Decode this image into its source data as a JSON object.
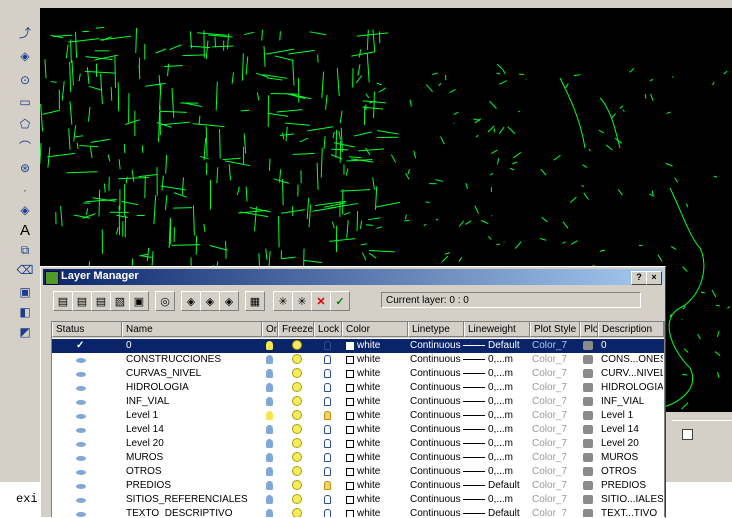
{
  "layer_manager": {
    "title": "Layer Manager",
    "help_button": "?",
    "close_button": "×",
    "current_layer": "Current layer: 0 : 0",
    "columns": [
      "Status",
      "Name",
      "On",
      "Freeze",
      "Lock",
      "Color",
      "Linetype",
      "Lineweight",
      "Plot Style",
      "Plot",
      "Description"
    ],
    "rows": [
      {
        "name": "0",
        "color": "white",
        "linetype": "Continuous",
        "lineweight": "Default",
        "plot_style": "Color_7",
        "description": "0",
        "selected": true,
        "on": true,
        "lock_gold": false
      },
      {
        "name": "CONSTRUCCIONES",
        "color": "white",
        "linetype": "Continuous",
        "lineweight": "0,...m",
        "plot_style": "Color_7",
        "description": "CONS...ONES",
        "on": false,
        "lock_gold": false
      },
      {
        "name": "CURVAS_NIVEL",
        "color": "white",
        "linetype": "Continuous",
        "lineweight": "0,...m",
        "plot_style": "Color_7",
        "description": "CURV...NIVEL",
        "on": false,
        "lock_gold": false
      },
      {
        "name": "HIDROLOGIA",
        "color": "white",
        "linetype": "Continuous",
        "lineweight": "0,...m",
        "plot_style": "Color_7",
        "description": "HIDROLOGIA",
        "on": false,
        "lock_gold": false
      },
      {
        "name": "INF_VIAL",
        "color": "white",
        "linetype": "Continuous",
        "lineweight": "0,...m",
        "plot_style": "Color_7",
        "description": "INF_VIAL",
        "on": false,
        "lock_gold": false
      },
      {
        "name": "Level 1",
        "color": "white",
        "linetype": "Continuous",
        "lineweight": "0,...m",
        "plot_style": "Color_7",
        "description": "Level 1",
        "on": true,
        "lock_gold": true
      },
      {
        "name": "Level 14",
        "color": "white",
        "linetype": "Continuous",
        "lineweight": "0,...m",
        "plot_style": "Color_7",
        "description": "Level 14",
        "on": false,
        "lock_gold": false
      },
      {
        "name": "Level 20",
        "color": "white",
        "linetype": "Continuous",
        "lineweight": "0,...m",
        "plot_style": "Color_7",
        "description": "Level 20",
        "on": false,
        "lock_gold": false
      },
      {
        "name": "MUROS",
        "color": "white",
        "linetype": "Continuous",
        "lineweight": "0,...m",
        "plot_style": "Color_7",
        "description": "MUROS",
        "on": false,
        "lock_gold": false
      },
      {
        "name": "OTROS",
        "color": "white",
        "linetype": "Continuous",
        "lineweight": "0,...m",
        "plot_style": "Color_7",
        "description": "OTROS",
        "on": false,
        "lock_gold": false
      },
      {
        "name": "PREDIOS",
        "color": "white",
        "linetype": "Continuous",
        "lineweight": "Default",
        "plot_style": "Color_7",
        "description": "PREDIOS",
        "on": false,
        "lock_gold": true
      },
      {
        "name": "SITIOS_REFERENCIALES",
        "color": "white",
        "linetype": "Continuous",
        "lineweight": "0,...m",
        "plot_style": "Color_7",
        "description": "SITIO...IALES",
        "on": false,
        "lock_gold": false
      },
      {
        "name": "TEXTO_DESCRIPTIVO",
        "color": "white",
        "linetype": "Continuous",
        "lineweight": "Default",
        "plot_style": "Color_7",
        "description": "TEXT...TIVO",
        "on": false,
        "lock_gold": false
      }
    ]
  },
  "command_line": {
    "text": "exi"
  },
  "colors": {
    "canvas": "#000000",
    "drawing": "#00ff2a",
    "titlebar": "#0a246a",
    "selection": "#0a246a"
  },
  "icons": [
    "polyline-icon",
    "offset-icon",
    "circle-icon",
    "rectangle-icon",
    "polygon-icon",
    "arc-icon",
    "hatch-icon",
    "point-icon",
    "block-icon",
    "text-icon",
    "insert-icon",
    "erase-icon",
    "copy-icon",
    "properties-icon",
    "layer-icon"
  ]
}
